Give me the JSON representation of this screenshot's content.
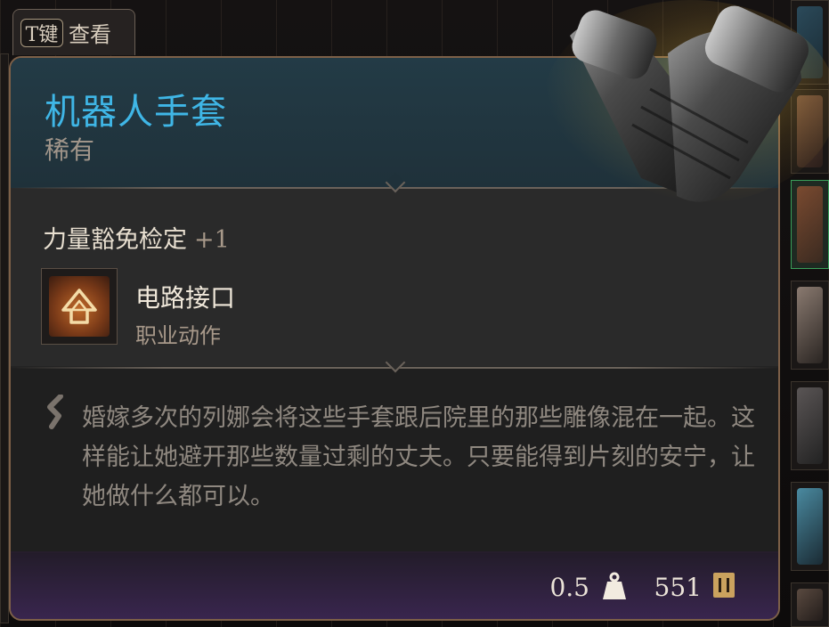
{
  "keyhint": {
    "key": "T键",
    "label": "查看"
  },
  "item": {
    "name": "机器人手套",
    "rarity": "稀有",
    "name_color": "#3fb6e6",
    "icon": "gauntlet-icon"
  },
  "stat": {
    "label": "力量豁免检定",
    "bonus": "+1"
  },
  "ability": {
    "name": "电路接口",
    "type": "职业动作",
    "icon": "arrow-up-icon"
  },
  "description": "婚嫁多次的列娜会将这些手套跟后院里的那些雕像混在一起。这样能让她避开那些数量过剩的丈夫。只要能得到片刻的安宁，让她做什么都可以。",
  "footer": {
    "weight": "0.5",
    "weight_icon": "weight-icon",
    "price": "551",
    "price_icon": "gold-coin-icon"
  }
}
